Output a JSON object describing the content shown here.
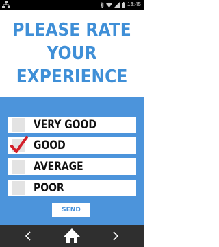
{
  "status_bar": {
    "time": "13:45",
    "icons": [
      "network-icon",
      "bluetooth-icon",
      "wifi-icon",
      "signal-icon",
      "battery-icon"
    ]
  },
  "title": {
    "lines": [
      "PLEASE RATE",
      "YOUR",
      "EXPERIENCE"
    ]
  },
  "options": [
    {
      "label": "VERY GOOD",
      "checked": false
    },
    {
      "label": "GOOD",
      "checked": true
    },
    {
      "label": "AVERAGE",
      "checked": false
    },
    {
      "label": "POOR",
      "checked": false
    }
  ],
  "send_label": "SEND",
  "nav": {
    "icons": [
      "back-arrow-icon",
      "home-icon",
      "forward-arrow-icon"
    ]
  },
  "colors": {
    "accent": "#4c94db",
    "title": "#3f8fd7",
    "check": "#d3202a",
    "checkbox": "#e3e3e3",
    "nav_bar": "#2f2f2f",
    "status_bar": "#000000"
  }
}
